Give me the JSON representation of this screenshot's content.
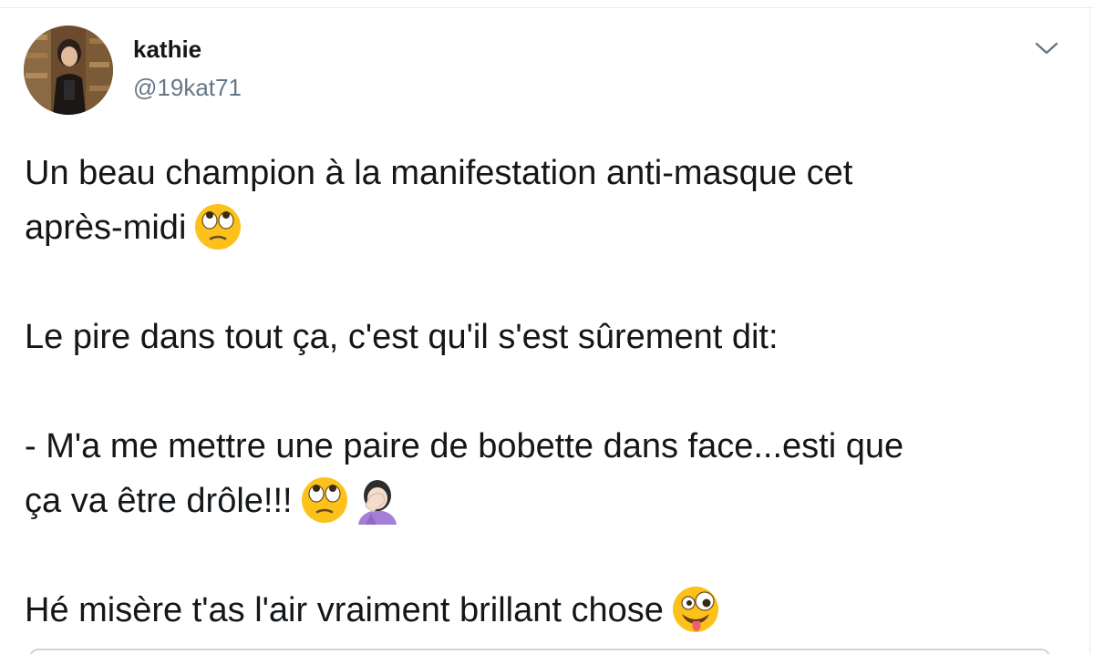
{
  "tweet": {
    "author": {
      "name": "kathie",
      "handle": "@19kat71"
    },
    "menu_icon": "chevron-down-icon",
    "lines": [
      "Un beau champion à la manifestation anti-masque cet",
      "après-midi",
      "Le pire dans tout ça, c'est qu'il s'est sûrement dit:",
      "- M'a me mettre une paire de bobette dans face...esti que",
      "ça va être drôle!!!",
      "Hé misère t'as l'air vraiment brillant chose"
    ],
    "emojis": {
      "line2": [
        "face-with-rolling-eyes-icon"
      ],
      "line5": [
        "face-with-rolling-eyes-icon",
        "woman-facepalming-icon"
      ],
      "line6": [
        "zany-face-icon"
      ]
    }
  },
  "colors": {
    "text": "#14171a",
    "secondary_text": "#657786",
    "border": "#e6ecf0",
    "emoji_yellow": "#fcc21b",
    "facepalm_purple": "#a57ed6"
  }
}
